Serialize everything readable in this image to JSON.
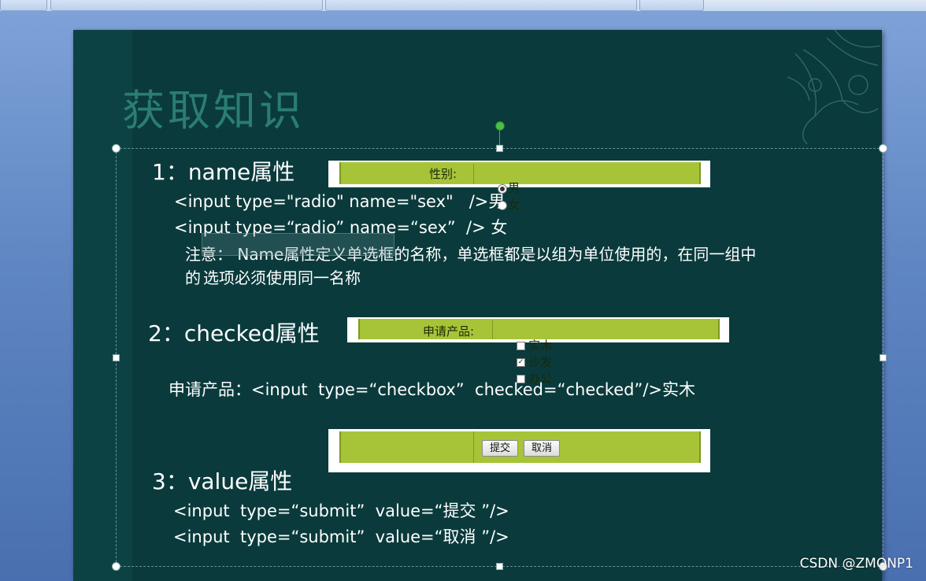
{
  "slide": {
    "title": "获取知识",
    "section1": {
      "heading": "1：name属性",
      "code1": "<input type=\"radio\" name=\"sex\"   />男",
      "code2": "<input type=“radio” name=“sex”  /> 女",
      "note_line1": "注意： Name属性定义单选框的名称，单选框都是以组为单位使用的，在同一组中",
      "note_line2_pre": "的",
      "note_line2_sel": "选项必须使用同一名称",
      "demo": {
        "label": "性别:",
        "option1": "男",
        "option2": "女"
      }
    },
    "section2": {
      "heading": "2：checked属性",
      "code": "申请产品：<input  type=“checkbox”  checked=“checked”/>实木",
      "demo": {
        "label": "申请产品:",
        "option1": "实木",
        "option2": "沙发",
        "option3": "办公"
      }
    },
    "section3": {
      "heading": "3：value属性",
      "code1": "<input  type=“submit”  value=“提交 ”/>",
      "code2": "<input  type=“submit”  value=“取消 ”/>",
      "demo": {
        "submit_label": "提交",
        "cancel_label": "取消"
      }
    }
  },
  "watermark": "CSDN @ZMONP1",
  "colors": {
    "slide_bg": "#0a3a3c",
    "title": "#2b7d72",
    "demo_green": "#a7c439",
    "handle_green": "#48c04a"
  }
}
